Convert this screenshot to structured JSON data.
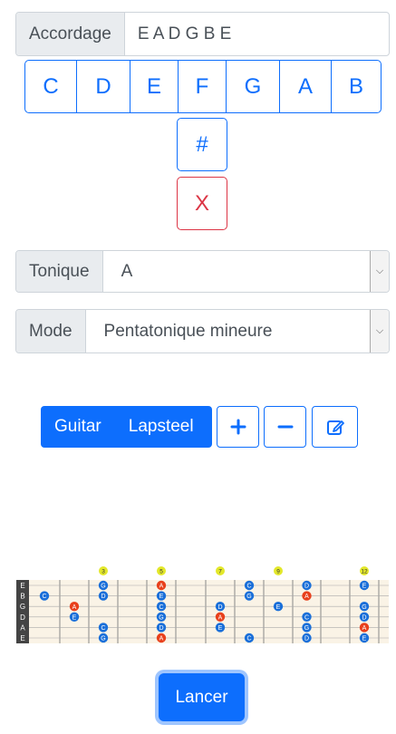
{
  "tuning": {
    "label": "Accordage",
    "value": "E A D G B E"
  },
  "notes": [
    "C",
    "D",
    "E",
    "F",
    "G",
    "A",
    "B"
  ],
  "sharp_label": "#",
  "clear_label": "X",
  "tonic": {
    "label": "Tonique",
    "value": "A"
  },
  "mode": {
    "label": "Mode",
    "value": "Pentatonique mineure"
  },
  "instruments": {
    "guitar": "Guitar",
    "lapsteel": "Lapsteel"
  },
  "launch_label": "Lancer",
  "fretboard": {
    "strings": [
      "E",
      "B",
      "G",
      "D",
      "A",
      "E"
    ],
    "fret_markers": [
      "3",
      "5",
      "7",
      "9",
      "12"
    ],
    "colors": {
      "accent": "#0d6efd",
      "note": "#1a6fd9",
      "root": "#e8401c",
      "marker": "#e3e82a",
      "wood": "#faf3e6"
    },
    "notes": [
      {
        "fret": 3,
        "string": 0,
        "label": "G",
        "root": false
      },
      {
        "fret": 5,
        "string": 0,
        "label": "A",
        "root": true
      },
      {
        "fret": 8,
        "string": 0,
        "label": "C",
        "root": false
      },
      {
        "fret": 10,
        "string": 0,
        "label": "D",
        "root": false
      },
      {
        "fret": 12,
        "string": 0,
        "label": "E",
        "root": false
      },
      {
        "fret": 1,
        "string": 1,
        "label": "C",
        "root": false
      },
      {
        "fret": 3,
        "string": 1,
        "label": "D",
        "root": false
      },
      {
        "fret": 5,
        "string": 1,
        "label": "E",
        "root": false
      },
      {
        "fret": 8,
        "string": 1,
        "label": "G",
        "root": false
      },
      {
        "fret": 10,
        "string": 1,
        "label": "A",
        "root": true
      },
      {
        "fret": 2,
        "string": 2,
        "label": "A",
        "root": true
      },
      {
        "fret": 5,
        "string": 2,
        "label": "C",
        "root": false
      },
      {
        "fret": 7,
        "string": 2,
        "label": "D",
        "root": false
      },
      {
        "fret": 9,
        "string": 2,
        "label": "E",
        "root": false
      },
      {
        "fret": 12,
        "string": 2,
        "label": "G",
        "root": false
      },
      {
        "fret": 2,
        "string": 3,
        "label": "E",
        "root": false
      },
      {
        "fret": 5,
        "string": 3,
        "label": "G",
        "root": false
      },
      {
        "fret": 7,
        "string": 3,
        "label": "A",
        "root": true
      },
      {
        "fret": 10,
        "string": 3,
        "label": "C",
        "root": false
      },
      {
        "fret": 12,
        "string": 3,
        "label": "D",
        "root": false
      },
      {
        "fret": 3,
        "string": 4,
        "label": "C",
        "root": false
      },
      {
        "fret": 5,
        "string": 4,
        "label": "D",
        "root": false
      },
      {
        "fret": 7,
        "string": 4,
        "label": "E",
        "root": false
      },
      {
        "fret": 10,
        "string": 4,
        "label": "G",
        "root": false
      },
      {
        "fret": 12,
        "string": 4,
        "label": "A",
        "root": true
      },
      {
        "fret": 3,
        "string": 5,
        "label": "G",
        "root": false
      },
      {
        "fret": 5,
        "string": 5,
        "label": "A",
        "root": true
      },
      {
        "fret": 8,
        "string": 5,
        "label": "C",
        "root": false
      },
      {
        "fret": 10,
        "string": 5,
        "label": "D",
        "root": false
      },
      {
        "fret": 12,
        "string": 5,
        "label": "E",
        "root": false
      }
    ]
  }
}
